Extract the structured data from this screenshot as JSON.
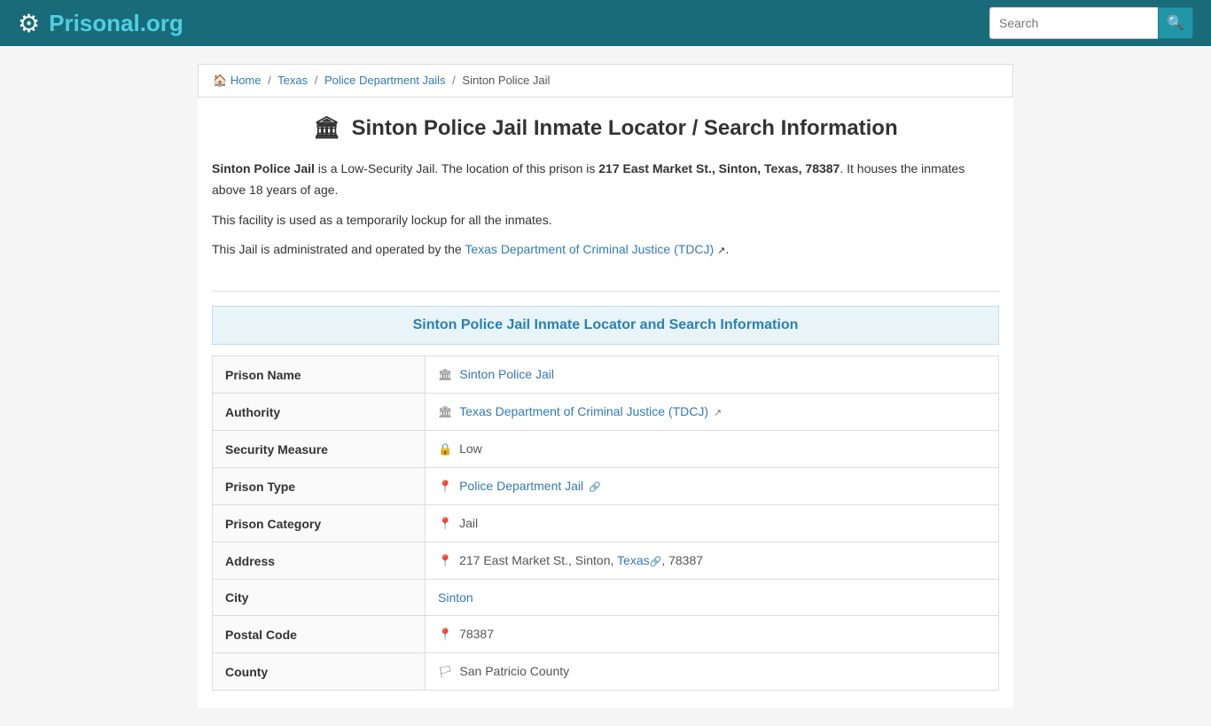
{
  "header": {
    "logo_main": "Prisonal",
    "logo_accent": ".org",
    "search_placeholder": "Search"
  },
  "breadcrumb": {
    "home": "Home",
    "texas": "Texas",
    "police_dept_jails": "Police Department Jails",
    "current": "Sinton Police Jail"
  },
  "page": {
    "title": "Sinton Police Jail Inmate Locator / Search Information",
    "description_1_pre": "Sinton Police Jail",
    "description_1_mid": " is a Low-Security Jail. The location of this prison is ",
    "description_1_address": "217 East Market St., Sinton, Texas, 78387",
    "description_1_post": ". It houses the inmates above 18 years of age.",
    "description_2": "This facility is used as a temporarily lockup for all the inmates.",
    "description_3_pre": "This Jail is administrated and operated by the ",
    "description_3_link": "Texas Department of Criminal Justice (TDCJ)",
    "description_3_post": ".",
    "info_table_header": "Sinton Police Jail Inmate Locator and Search Information"
  },
  "table": {
    "rows": [
      {
        "label": "Prison Name",
        "icon": "🏛",
        "value": "Sinton Police Jail",
        "link": true
      },
      {
        "label": "Authority",
        "icon": "🏛",
        "value": "Texas Department of Criminal Justice (TDCJ)",
        "link": true,
        "external": true
      },
      {
        "label": "Security Measure",
        "icon": "🔒",
        "value": "Low",
        "link": false
      },
      {
        "label": "Prison Type",
        "icon": "📍",
        "value": "Police Department Jail",
        "link": true,
        "has_anchor": true
      },
      {
        "label": "Prison Category",
        "icon": "📍",
        "value": "Jail",
        "link": false
      },
      {
        "label": "Address",
        "icon": "📍",
        "value_pre": "217 East Market St., Sinton, ",
        "value_link": "Texas",
        "value_post": ", 78387",
        "link": false,
        "is_address": true
      },
      {
        "label": "City",
        "icon": "",
        "value": "Sinton",
        "link": true
      },
      {
        "label": "Postal Code",
        "icon": "📍",
        "value": "78387",
        "link": false
      },
      {
        "label": "County",
        "icon": "🏳",
        "value": "San Patricio County",
        "link": false
      }
    ]
  }
}
